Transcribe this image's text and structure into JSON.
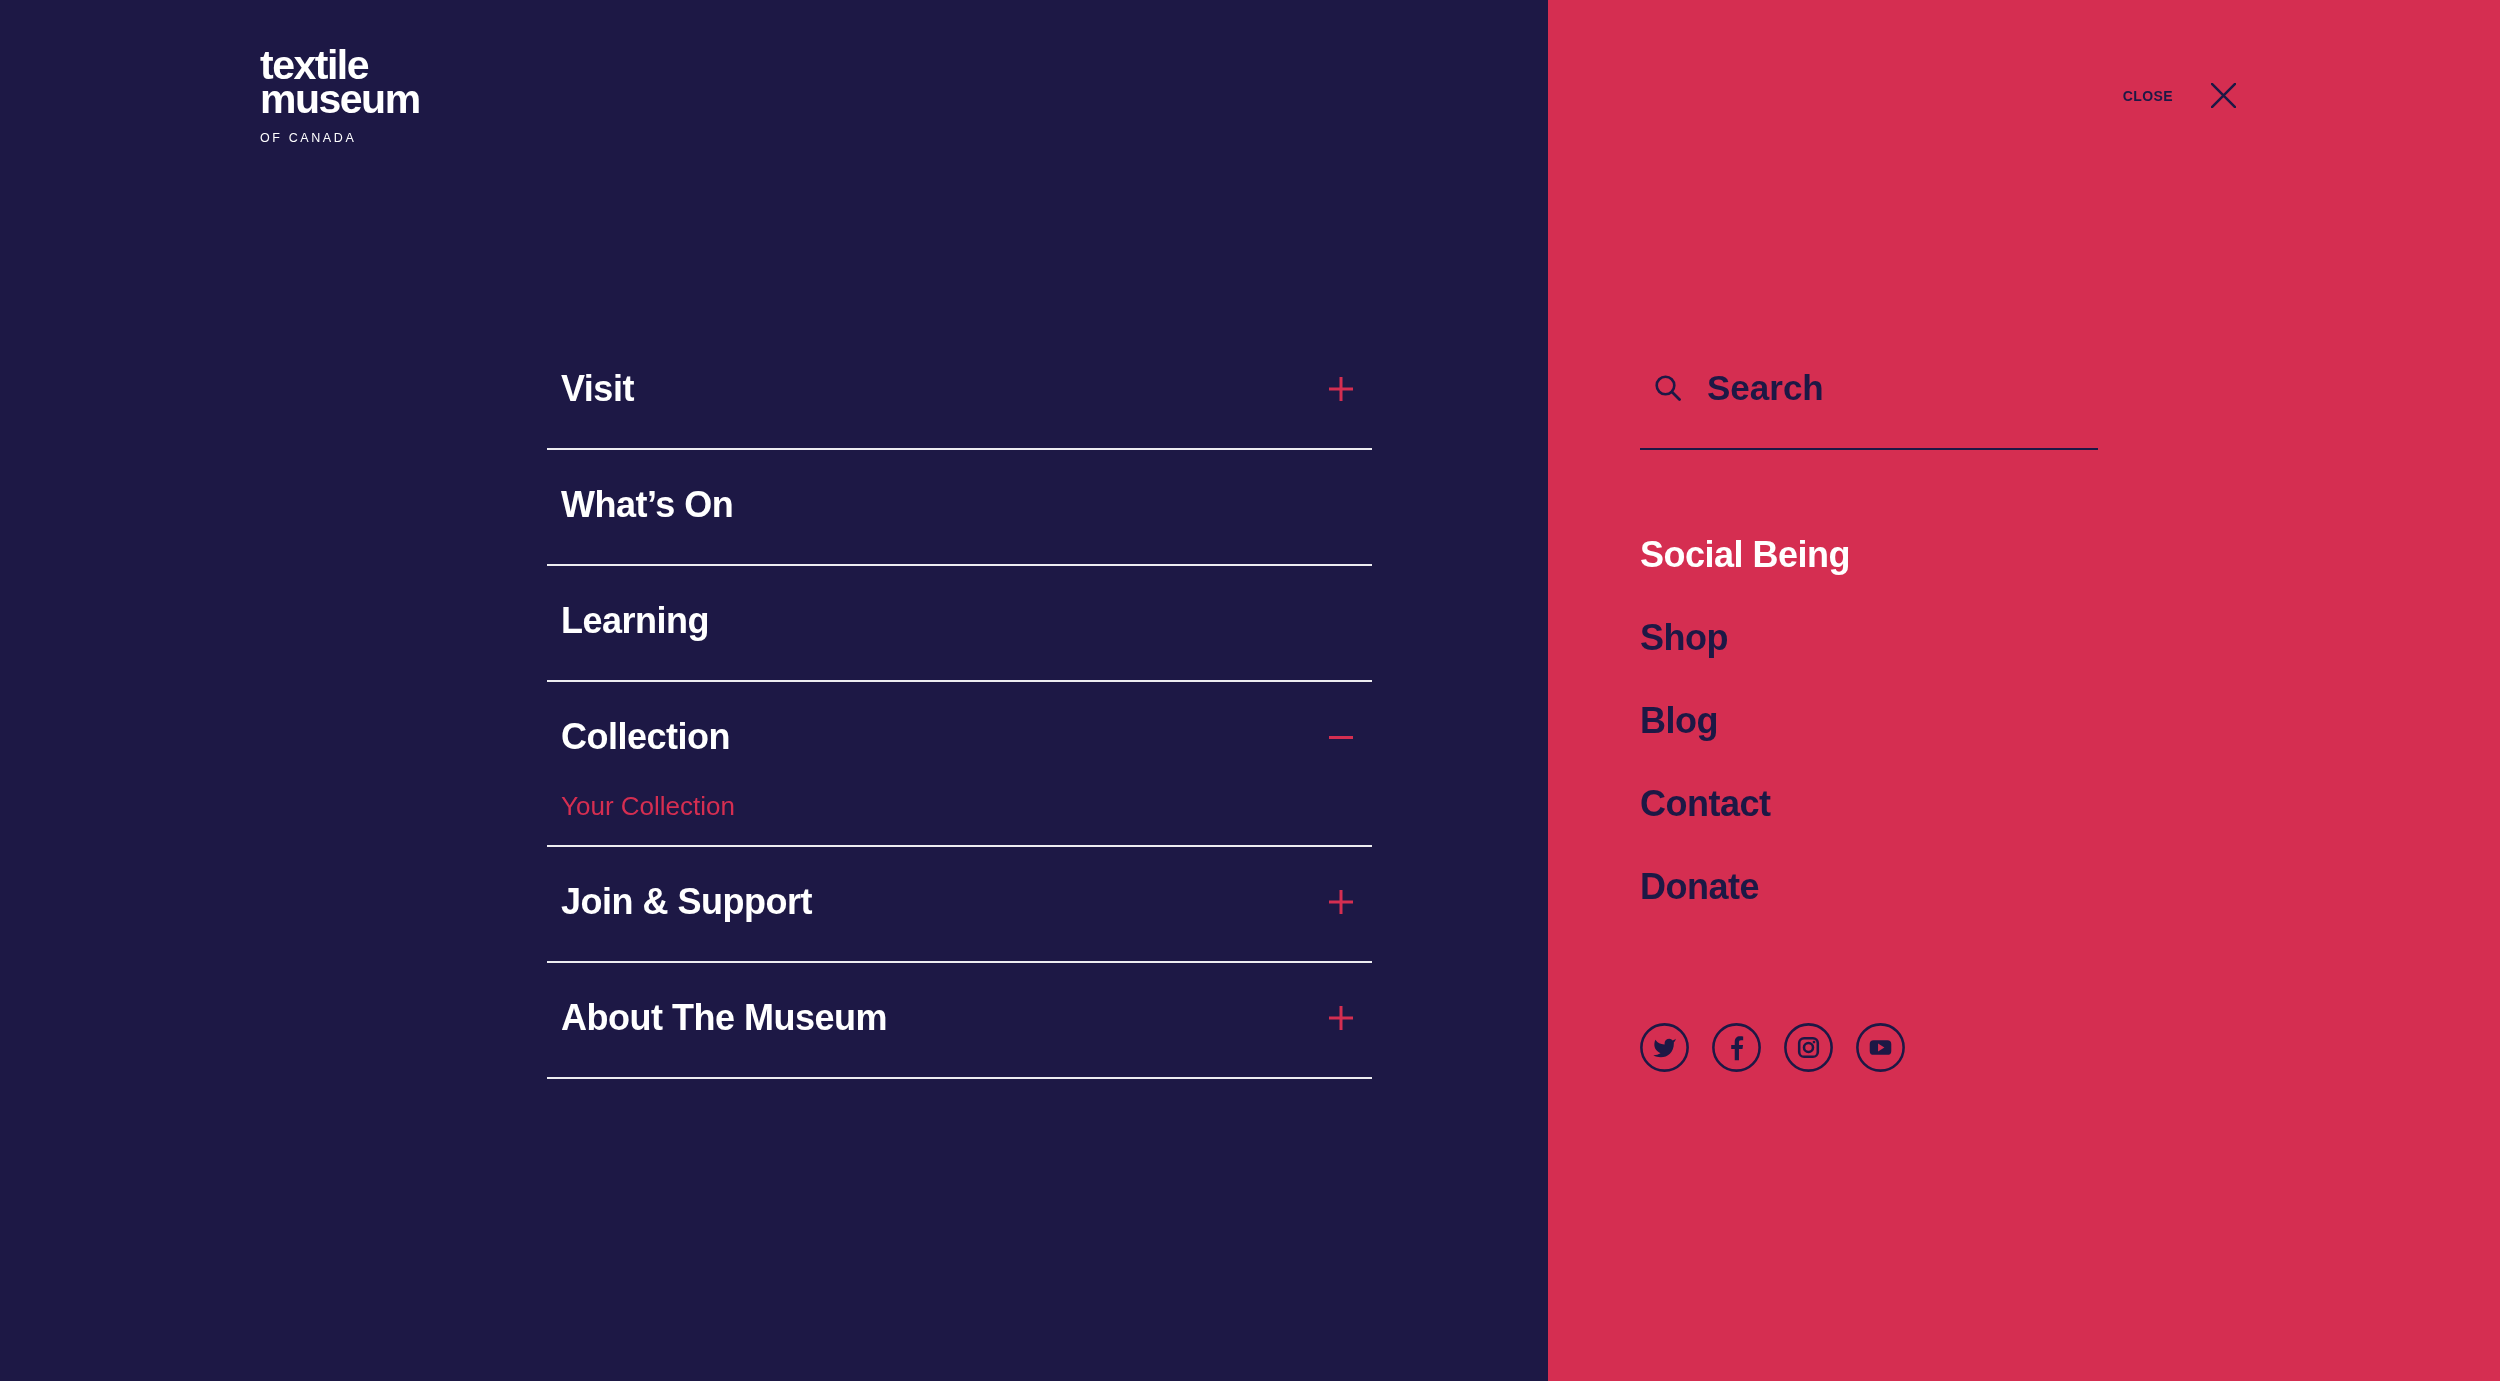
{
  "logo": {
    "line_1": "textile",
    "line_2": "museum",
    "tagline": "OF CANADA"
  },
  "close_button": {
    "label": "CLOSE"
  },
  "main_menu": [
    {
      "label": "Visit",
      "kind": "group",
      "expanded": false
    },
    {
      "label": "What’s On",
      "kind": "link"
    },
    {
      "label": "Learning",
      "kind": "link"
    },
    {
      "label": "Collection",
      "kind": "group",
      "expanded": true,
      "children": [
        {
          "label": "Your Collection"
        }
      ]
    },
    {
      "label": "Join & Support",
      "kind": "group",
      "expanded": false
    },
    {
      "label": "About The Museum",
      "kind": "group",
      "expanded": false
    }
  ],
  "search": {
    "placeholder": "Search"
  },
  "secondary_menu": [
    {
      "label": "Social Being",
      "selected": true
    },
    {
      "label": "Shop",
      "selected": false
    },
    {
      "label": "Blog",
      "selected": false
    },
    {
      "label": "Contact",
      "selected": false
    },
    {
      "label": "Donate",
      "selected": false
    }
  ]
}
